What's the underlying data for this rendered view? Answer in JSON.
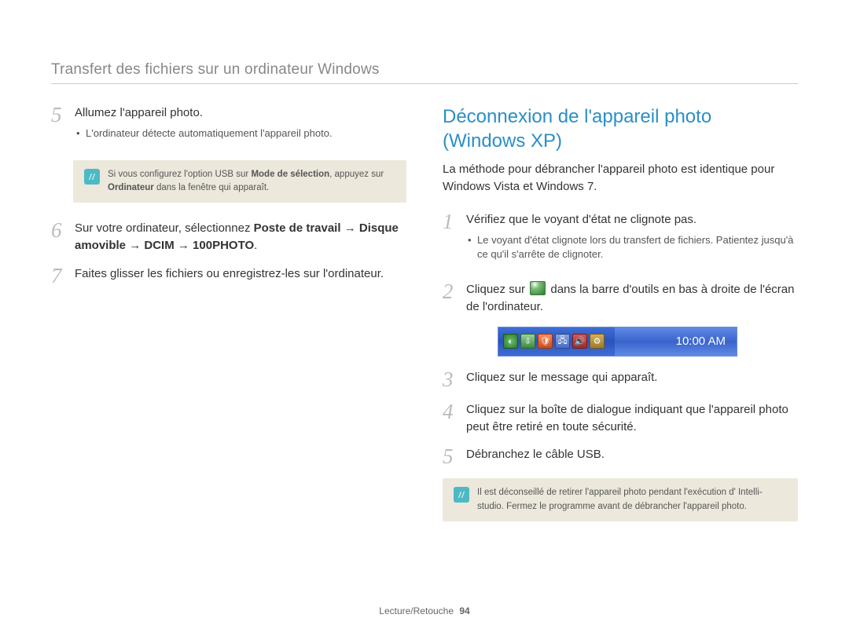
{
  "header": {
    "title": "Transfert des fichiers sur un ordinateur Windows"
  },
  "left": {
    "steps": [
      {
        "num": "5",
        "text": "Allumez l'appareil photo.",
        "bullets": [
          "L'ordinateur détecte automatiquement l'appareil photo."
        ]
      },
      {
        "num": "6",
        "html": "Sur votre ordinateur, sélectionnez <b>Poste de travail</b> → <b>Disque amovible</b> → <b>DCIM</b> → <b>100PHOTO</b>."
      },
      {
        "num": "7",
        "text": "Faites glisser les fichiers ou enregistrez-les sur l'ordinateur."
      }
    ],
    "note": "Si vous configurez l'option USB sur <b>Mode de sélection</b>, appuyez sur <b>Ordinateur</b> dans la fenêtre qui apparaît."
  },
  "right": {
    "heading": "Déconnexion de l'appareil photo (Windows XP)",
    "intro": "La méthode pour débrancher l'appareil photo est identique pour Windows Vista et Windows 7.",
    "steps": [
      {
        "num": "1",
        "text": "Vérifiez que le voyant d'état ne clignote pas.",
        "bullets": [
          "Le voyant d'état clignote lors du transfert de fichiers. Patientez jusqu'à ce qu'il s'arrête de clignoter."
        ]
      },
      {
        "num": "2",
        "pre": "Cliquez sur ",
        "post": " dans la barre d'outils en bas à droite de l'écran de l'ordinateur."
      },
      {
        "num": "3",
        "text": "Cliquez sur le message qui apparaît."
      },
      {
        "num": "4",
        "text": "Cliquez sur la boîte de dialogue indiquant que l'appareil photo peut être retiré en toute sécurité."
      },
      {
        "num": "5",
        "text": "Débranchez le câble USB."
      }
    ],
    "taskbar": {
      "clock": "10:00 AM"
    },
    "note": "Il est déconseillé de retirer l'appareil photo pendant l'exécution d' Intelli-studio. Fermez le programme avant de débrancher l'appareil photo."
  },
  "footer": {
    "section": "Lecture/Retouche",
    "page": "94"
  }
}
